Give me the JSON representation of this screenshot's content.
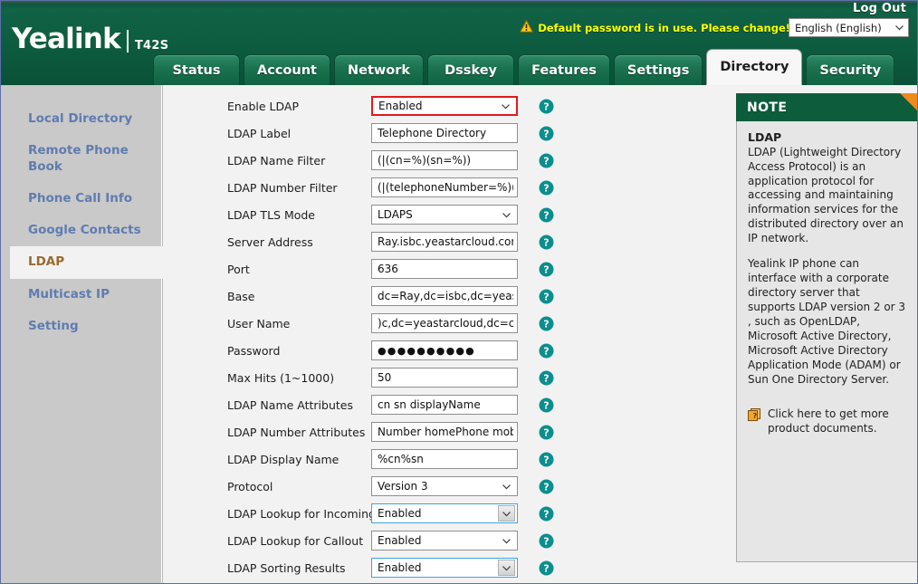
{
  "header": {
    "logout_label": "Log Out",
    "warning_text": "Default password is in use. Please change!",
    "warning_icon": "warning-triangle-icon",
    "language_value": "English (English)",
    "brand": "Yealink",
    "model": "T42S"
  },
  "tabs": [
    {
      "label": "Status",
      "active": false
    },
    {
      "label": "Account",
      "active": false
    },
    {
      "label": "Network",
      "active": false
    },
    {
      "label": "Dsskey",
      "active": false
    },
    {
      "label": "Features",
      "active": false
    },
    {
      "label": "Settings",
      "active": false
    },
    {
      "label": "Directory",
      "active": true
    },
    {
      "label": "Security",
      "active": false
    }
  ],
  "sidebar": {
    "items": [
      {
        "label": "Local Directory",
        "active": false
      },
      {
        "label": "Remote Phone Book",
        "active": false
      },
      {
        "label": "Phone Call Info",
        "active": false
      },
      {
        "label": "Google Contacts",
        "active": false
      },
      {
        "label": "LDAP",
        "active": true
      },
      {
        "label": "Multicast IP",
        "active": false
      },
      {
        "label": "Setting",
        "active": false
      }
    ]
  },
  "form": {
    "rows": [
      {
        "label": "Enable LDAP",
        "value": "Enabled",
        "type": "select",
        "state": "red"
      },
      {
        "label": "LDAP Label",
        "value": "Telephone Directory",
        "type": "text",
        "state": ""
      },
      {
        "label": "LDAP Name Filter",
        "value": "(|(cn=%)(sn=%))",
        "type": "text",
        "state": ""
      },
      {
        "label": "LDAP Number Filter",
        "value": "(|(telephoneNumber=%)(hc",
        "type": "text",
        "state": ""
      },
      {
        "label": "LDAP TLS Mode",
        "value": "LDAPS",
        "type": "select",
        "state": ""
      },
      {
        "label": "Server Address",
        "value": "Ray.isbc.yeastarcloud.com",
        "type": "text",
        "state": ""
      },
      {
        "label": "Port",
        "value": "636",
        "type": "text",
        "state": ""
      },
      {
        "label": "Base",
        "value": "dc=Ray,dc=isbc,dc=yeastar",
        "type": "text",
        "state": ""
      },
      {
        "label": "User Name",
        "value": ")c,dc=yeastarcloud,dc=com",
        "type": "text",
        "state": ""
      },
      {
        "label": "Password",
        "value": "●●●●●●●●●●",
        "type": "password",
        "state": ""
      },
      {
        "label": "Max Hits (1~1000)",
        "value": "50",
        "type": "text",
        "state": ""
      },
      {
        "label": "LDAP Name Attributes",
        "value": "cn sn displayName",
        "type": "text",
        "state": ""
      },
      {
        "label": "LDAP Number Attributes",
        "value": "Number homePhone mobile",
        "type": "text",
        "state": ""
      },
      {
        "label": "LDAP Display Name",
        "value": "%cn%sn",
        "type": "text",
        "state": ""
      },
      {
        "label": "Protocol",
        "value": "Version 3",
        "type": "select",
        "state": ""
      },
      {
        "label": "LDAP Lookup for Incoming Call",
        "value": "Enabled",
        "type": "select",
        "state": "blue"
      },
      {
        "label": "LDAP Lookup for Callout",
        "value": "Enabled",
        "type": "select",
        "state": ""
      },
      {
        "label": "LDAP Sorting Results",
        "value": "Enabled",
        "type": "select",
        "state": "blue"
      }
    ],
    "help_icon": "question-mark-help-icon"
  },
  "note": {
    "header": "NOTE",
    "title": "LDAP",
    "paragraph1": "LDAP (Lightweight Directory Access Protocol) is an application protocol for accessing and maintaining information services for the distributed directory over an IP network.",
    "paragraph2": "Yealink IP phone can interface with a corporate directory server that supports LDAP version 2 or 3 , such as OpenLDAP, Microsoft Active Directory, Microsoft Active Directory Application Mode (ADAM) or Sun One Directory Server.",
    "link_text": "Click here to get more product documents.",
    "link_icon": "document-pages-icon"
  },
  "colors": {
    "brand_green": "#0d5c3c",
    "accent_orange": "#f08a1e",
    "help_teal": "#0b8e8e",
    "warning_yellow": "#ffff00",
    "sidebar_link": "#5f7cb0",
    "sidebar_active": "#9a6a2e",
    "highlight_red": "#e01b1b",
    "highlight_blue": "#3aa7dd"
  }
}
